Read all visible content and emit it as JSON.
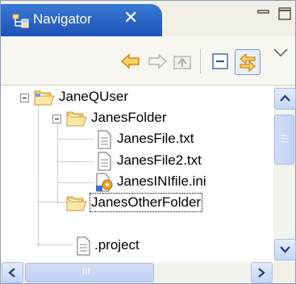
{
  "view": {
    "title": "Navigator",
    "close_glyph": "✕"
  },
  "colors": {
    "tab_blue": "#2a63c2",
    "folder_yellow": "#f5c95a",
    "arrow_orange": "#f0a020",
    "scroll_blue": "#c4d6f4"
  },
  "toolbar": {
    "buttons": [
      {
        "icon": "back-arrow-icon"
      },
      {
        "icon": "forward-arrow-icon"
      },
      {
        "icon": "up-folder-icon"
      },
      {
        "icon": "collapse-all-icon"
      },
      {
        "icon": "link-with-editor-icon"
      },
      {
        "icon": "view-menu-icon"
      }
    ]
  },
  "tree": {
    "items": [
      {
        "label": "JaneQUser",
        "type": "folder-open"
      },
      {
        "label": "JanesFolder",
        "type": "folder-open"
      },
      {
        "label": "JanesFile.txt",
        "type": "file"
      },
      {
        "label": "JanesFile2.txt",
        "type": "file"
      },
      {
        "label": "JanesINIfile.ini",
        "type": "ini-file"
      },
      {
        "label": "JanesOtherFolder",
        "type": "folder-open"
      },
      {
        "label": ".project",
        "type": "file"
      }
    ]
  },
  "scrollbars": {
    "horizontal_grip": "III"
  }
}
